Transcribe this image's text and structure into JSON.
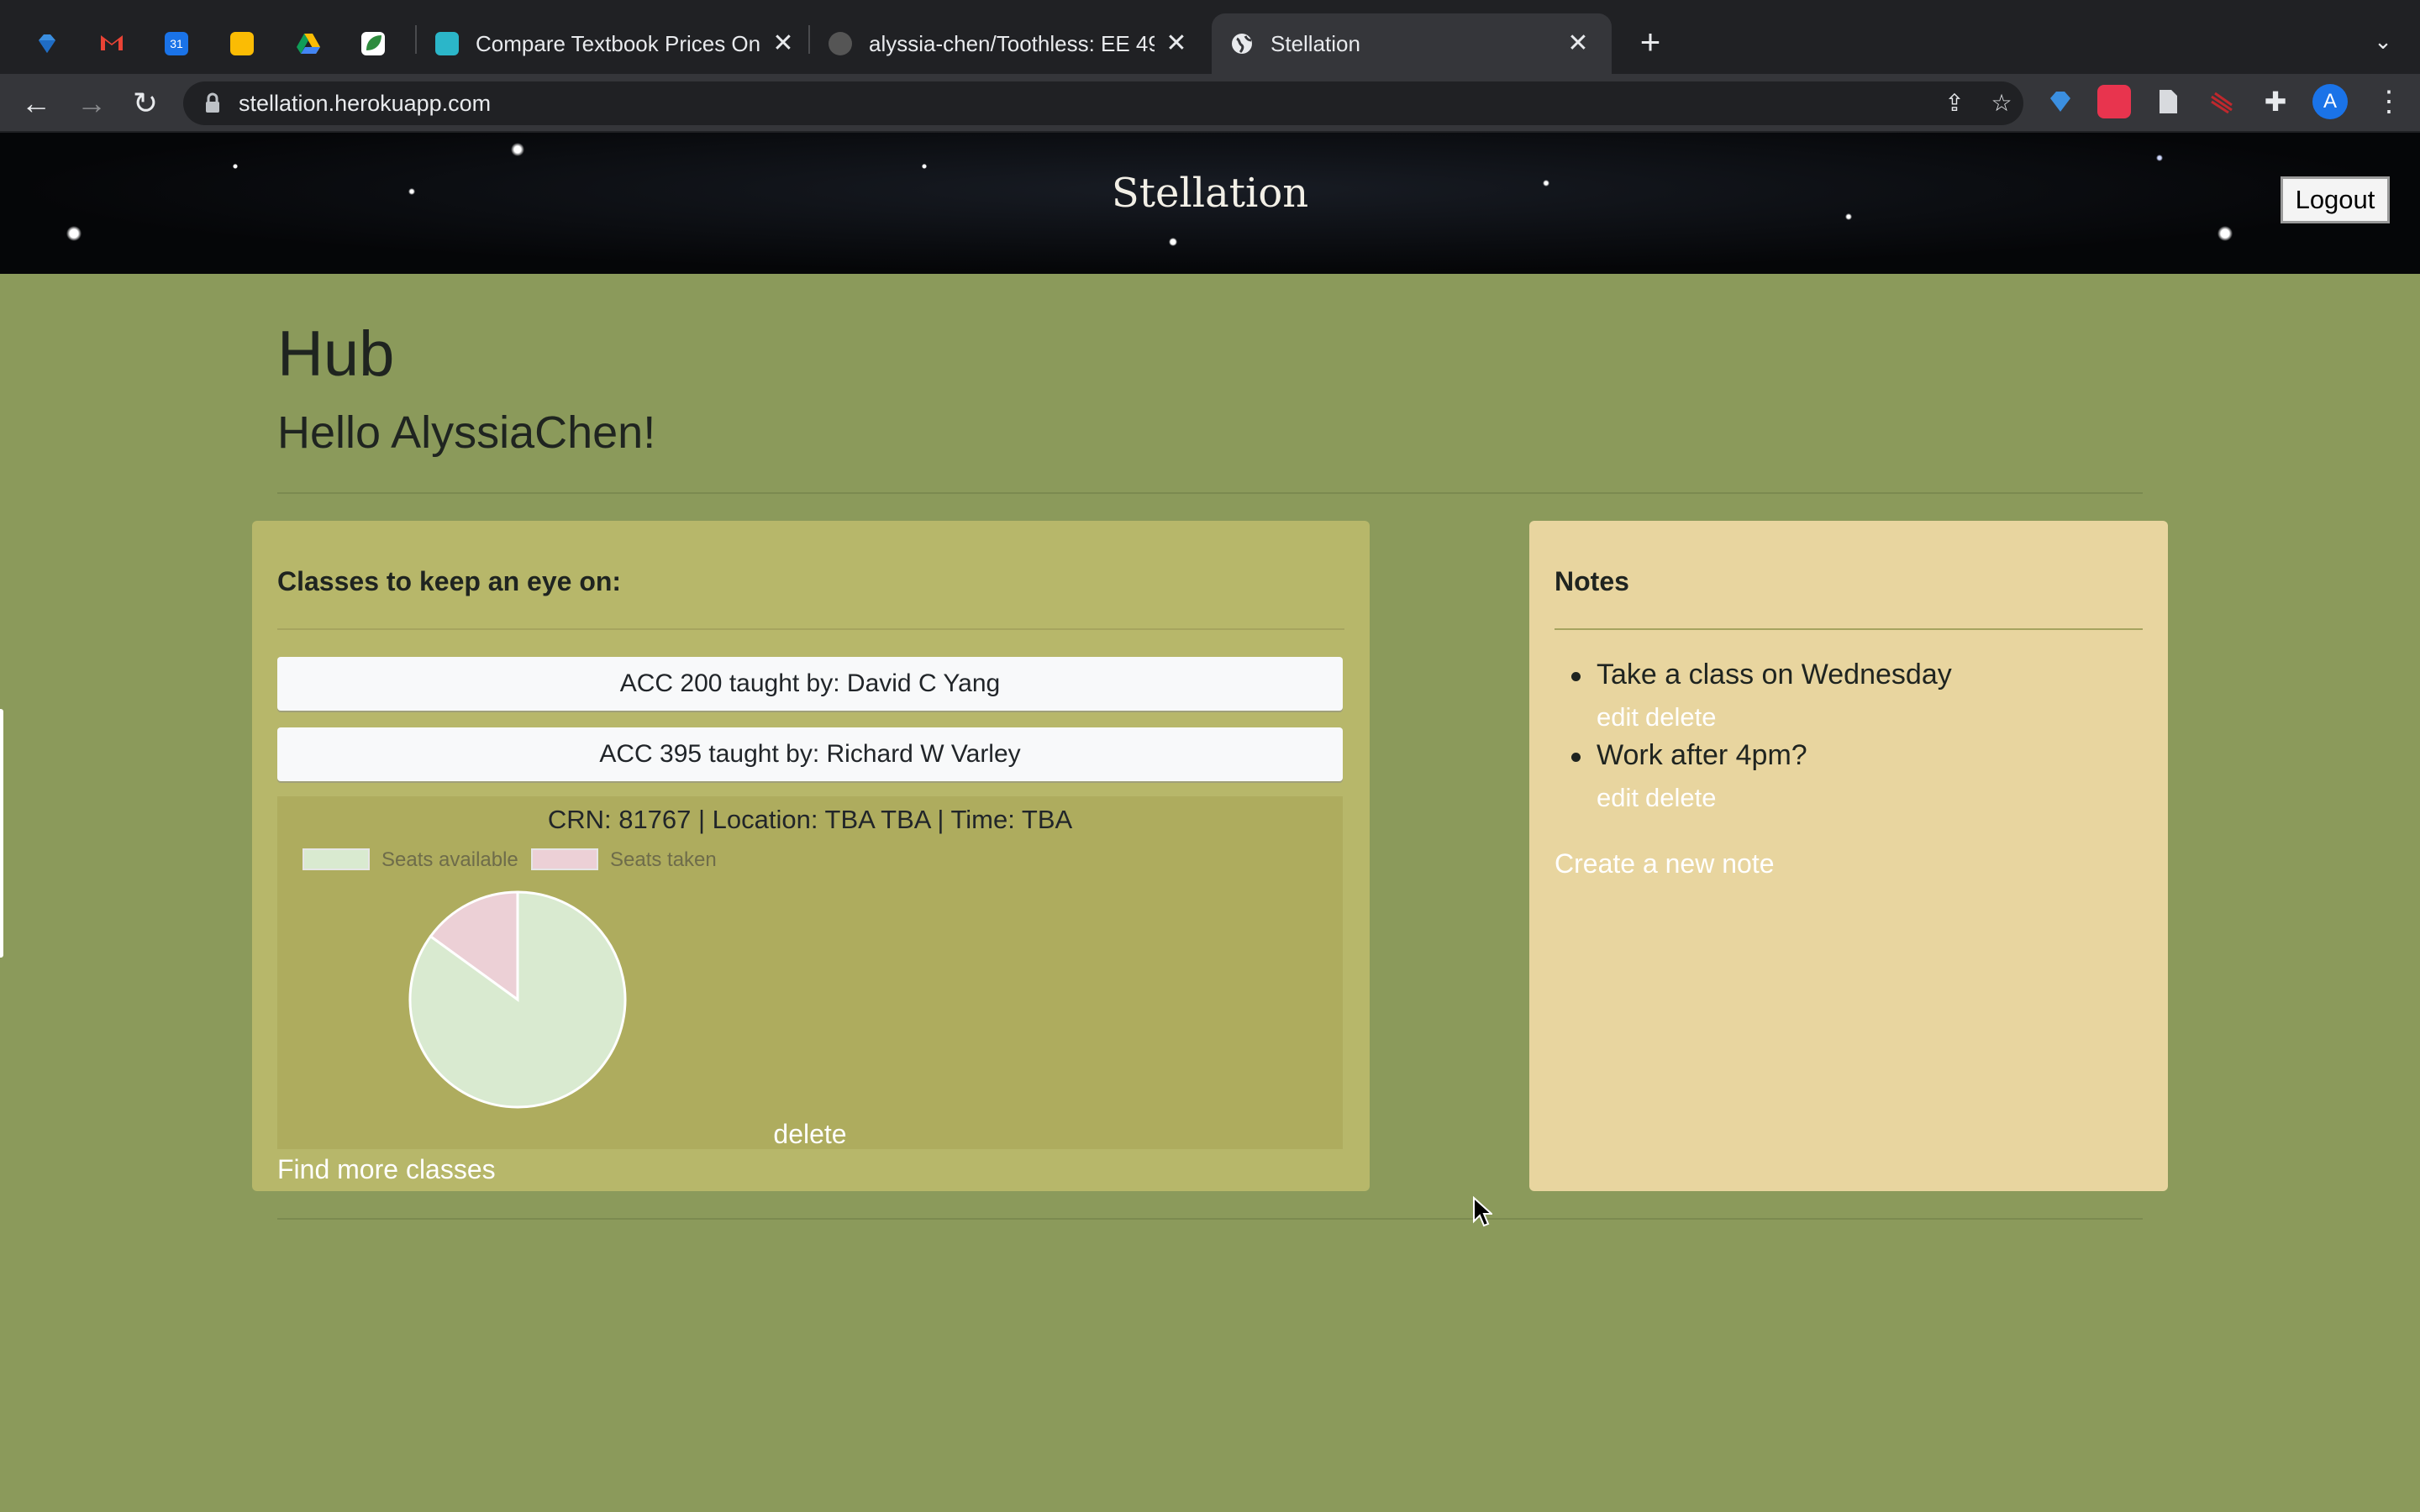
{
  "browser": {
    "tabs": [
      {
        "title": "Compare Textbook Prices Online",
        "active": false
      },
      {
        "title": "alyssia-chen/Toothless: EE 491",
        "active": false
      },
      {
        "title": "Stellation",
        "active": true
      }
    ],
    "url": "stellation.herokuapp.com",
    "profile_initial": "A",
    "colors": {
      "tabbar": "#202124",
      "toolbar": "#35363a"
    }
  },
  "header": {
    "site_title": "Stellation",
    "logout_label": "Logout"
  },
  "hub": {
    "title": "Hub",
    "greeting": "Hello AlyssiaChen!"
  },
  "classes": {
    "heading": "Classes to keep an eye on:",
    "items": [
      {
        "label": "ACC 200 taught by: David C Yang"
      },
      {
        "label": "ACC 395 taught by: Richard W Varley"
      }
    ],
    "detail": {
      "info": "CRN: 81767 | Location: TBA TBA | Time: TBA",
      "delete_label": "delete"
    },
    "find_more_label": "Find more classes"
  },
  "chart_data": {
    "type": "pie",
    "labels": [
      "Seats available",
      "Seats taken"
    ],
    "values": [
      85,
      15
    ],
    "colors": [
      "#d9ead0",
      "#ecd0d6"
    ],
    "legend": "top-left"
  },
  "notes": {
    "heading": "Notes",
    "items": [
      {
        "text": "Take a class on Wednesday",
        "edit": "edit",
        "delete": "delete"
      },
      {
        "text": "Work after 4pm?",
        "edit": "edit",
        "delete": "delete"
      }
    ],
    "create_label": "Create a new note"
  },
  "colors": {
    "page_bg": "#8b9a5b",
    "classes_card": "#b7b76a",
    "notes_card": "#e8d59f"
  }
}
